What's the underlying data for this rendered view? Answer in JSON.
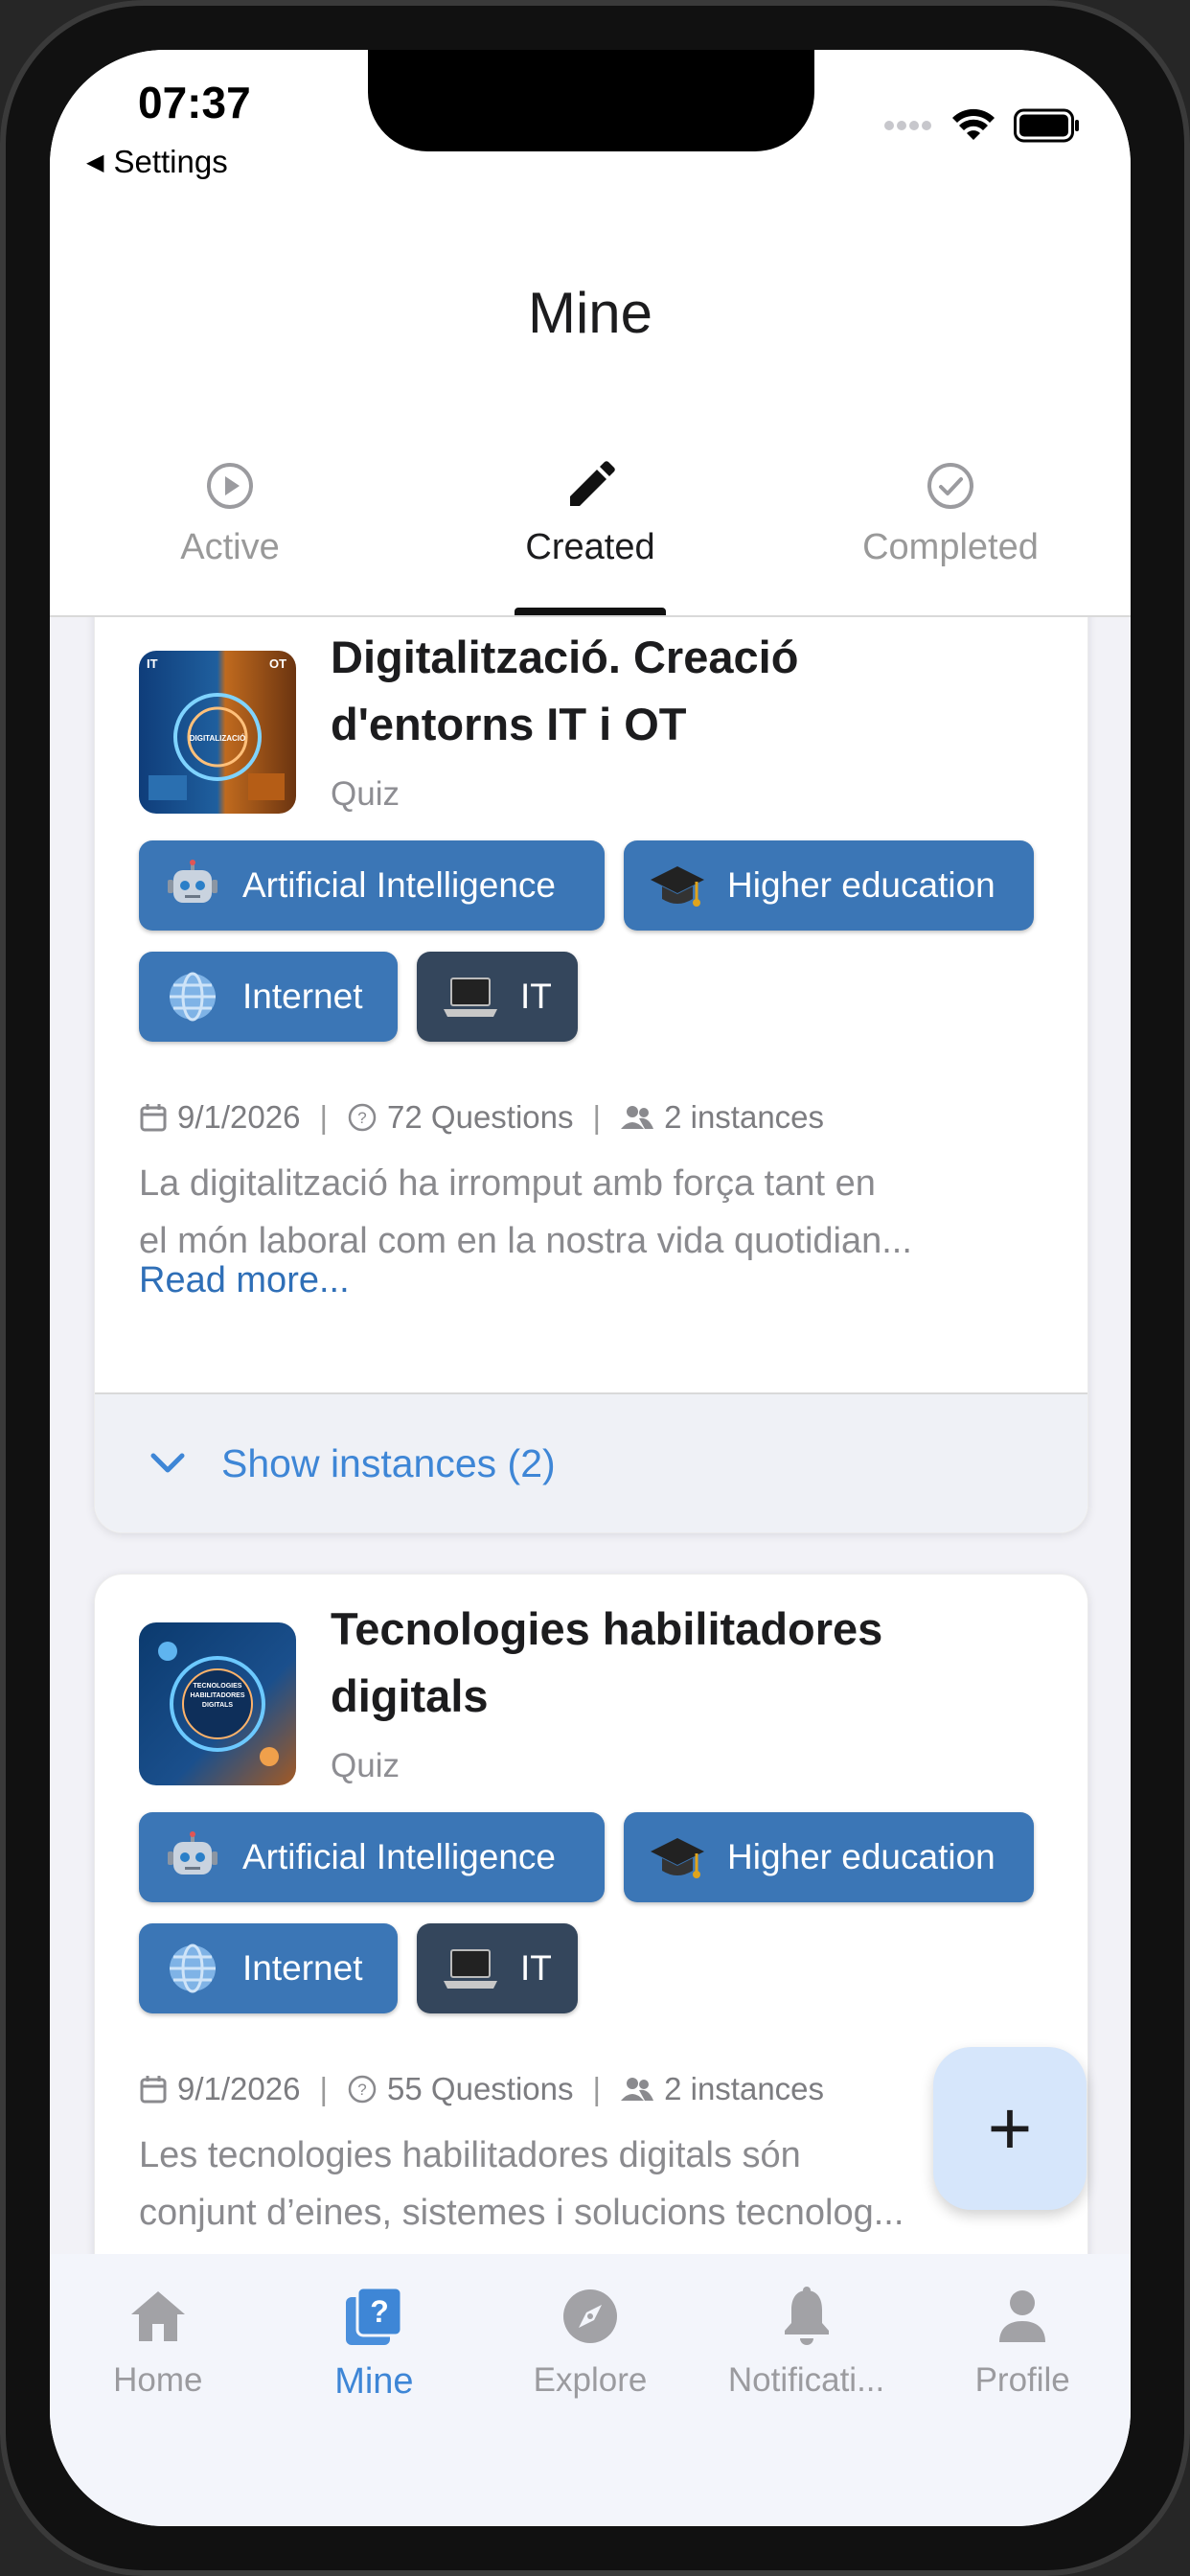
{
  "status_bar": {
    "time": "07:37",
    "back_label": "Settings"
  },
  "header": {
    "title": "Mine"
  },
  "tabs": [
    {
      "label": "Active",
      "icon": "play-circle-icon",
      "active": false
    },
    {
      "label": "Created",
      "icon": "pencil-icon",
      "active": true
    },
    {
      "label": "Completed",
      "icon": "check-circle-icon",
      "active": false
    }
  ],
  "cards": [
    {
      "title_line1": "Digitalització. Creació",
      "title_line2": "d'entorns IT i OT",
      "type": "Quiz",
      "thumb_left": "IT",
      "thumb_right": "OT",
      "thumb_center": "DIGITALIZACIÓ",
      "tags": [
        "Artificial Intelligence",
        "Higher education",
        "Internet",
        "IT"
      ],
      "date": "9/1/2026",
      "questions": "72 Questions",
      "instances": "2 instances",
      "desc_line1": "La digitalització ha irromput amb força tant en",
      "desc_line2": "el món laboral com en la nostra vida quotidian...",
      "read_more": "Read more...",
      "show_instances": "Show instances (2)"
    },
    {
      "title_line1": "Tecnologies habilitadores",
      "title_line2": "digitals",
      "type": "Quiz",
      "thumb_center": "TECNOLOGIES HABILITADORES DIGITALS",
      "tags": [
        "Artificial Intelligence",
        "Higher education",
        "Internet",
        "IT"
      ],
      "date": "9/1/2026",
      "questions": "55 Questions",
      "instances": "2 instances",
      "desc_line1": "Les tecnologies habilitadores digitals són",
      "desc_line2": "conjunt d’eines, sistemes i solucions tecnolog..."
    }
  ],
  "fab": {
    "label": "+"
  },
  "bottom_nav": [
    {
      "label": "Home",
      "icon": "home-icon",
      "active": false
    },
    {
      "label": "Mine",
      "icon": "quiz-question-icon",
      "active": true
    },
    {
      "label": "Explore",
      "icon": "compass-icon",
      "active": false
    },
    {
      "label": "Notificati...",
      "icon": "bell-icon",
      "active": false
    },
    {
      "label": "Profile",
      "icon": "person-icon",
      "active": false
    }
  ],
  "colors": {
    "accent_blue": "#3e86d6",
    "chip_blue": "#3b76b6",
    "chip_dark": "#34465c",
    "fab_bg": "#d6e6fb"
  }
}
